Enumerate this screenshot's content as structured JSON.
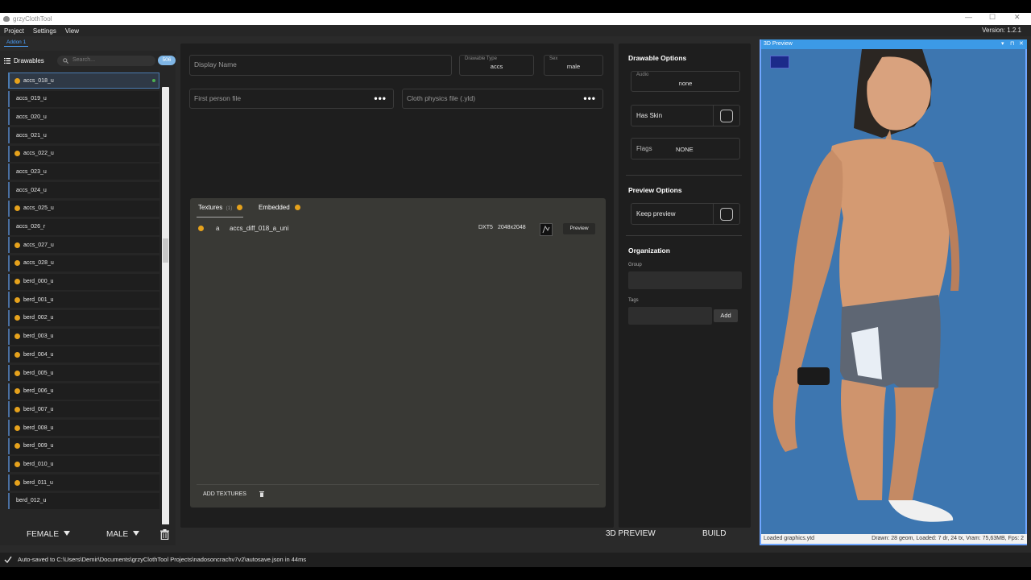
{
  "window": {
    "title": "grzyClothTool",
    "controls": [
      "—",
      "☐",
      "✕"
    ]
  },
  "menu": [
    "Project",
    "Settings",
    "View"
  ],
  "version": "Version: 1.2.1",
  "addon_tab": "Addon 1",
  "sidebar": {
    "header": "Drawables",
    "search_placeholder": "Search...",
    "count": "506",
    "items": [
      {
        "label": "accs_018_u",
        "warn": true,
        "selected": true
      },
      {
        "label": "accs_019_u",
        "warn": false
      },
      {
        "label": "accs_020_u",
        "warn": false
      },
      {
        "label": "accs_021_u",
        "warn": false
      },
      {
        "label": "accs_022_u",
        "warn": true
      },
      {
        "label": "accs_023_u",
        "warn": false
      },
      {
        "label": "accs_024_u",
        "warn": false
      },
      {
        "label": "accs_025_u",
        "warn": true
      },
      {
        "label": "accs_026_r",
        "warn": false
      },
      {
        "label": "accs_027_u",
        "warn": true
      },
      {
        "label": "accs_028_u",
        "warn": true
      },
      {
        "label": "berd_000_u",
        "warn": true
      },
      {
        "label": "berd_001_u",
        "warn": true
      },
      {
        "label": "berd_002_u",
        "warn": true
      },
      {
        "label": "berd_003_u",
        "warn": true
      },
      {
        "label": "berd_004_u",
        "warn": true
      },
      {
        "label": "berd_005_u",
        "warn": true
      },
      {
        "label": "berd_006_u",
        "warn": true
      },
      {
        "label": "berd_007_u",
        "warn": true
      },
      {
        "label": "berd_008_u",
        "warn": true
      },
      {
        "label": "berd_009_u",
        "warn": true
      },
      {
        "label": "berd_010_u",
        "warn": true
      },
      {
        "label": "berd_011_u",
        "warn": true
      },
      {
        "label": "berd_012_u",
        "warn": false
      }
    ],
    "female_label": "FEMALE",
    "male_label": "MALE"
  },
  "details": {
    "display_name_placeholder": "Display Name",
    "drawable_type_label": "Drawable Type",
    "drawable_type_value": "accs",
    "sex_label": "Sex",
    "sex_value": "male",
    "first_person_placeholder": "First person file",
    "cloth_physics_placeholder": "Cloth physics file (.yld)",
    "more": "•••"
  },
  "textures": {
    "tab_textures": "Textures",
    "tab_textures_count": "(1)",
    "tab_embedded": "Embedded",
    "rows": [
      {
        "letter": "a",
        "name": "accs_diff_018_a_uni",
        "format": "DXT5",
        "size": "2048x2048",
        "action": "Preview"
      }
    ],
    "add_label": "ADD TEXTURES"
  },
  "options": {
    "drawable_title": "Drawable Options",
    "audio_label": "Audio",
    "audio_value": "none",
    "has_skin": "Has Skin",
    "flags_label": "Flags",
    "flags_value": "NONE",
    "preview_title": "Preview Options",
    "keep_preview": "Keep preview",
    "org_title": "Organization",
    "group_label": "Group",
    "tags_label": "Tags",
    "add_label": "Add"
  },
  "actions": {
    "preview3d": "3D PREVIEW",
    "build": "BUILD"
  },
  "preview": {
    "title": "3D Preview",
    "controls": [
      "▾",
      "⊓",
      "✕"
    ],
    "status_left": "Loaded graphics.ytd",
    "status_right": "Drawn: 28 geom, Loaded: 7 dr, 24 tx, Vram: 75,63MB, Fps: 2",
    "colors": {
      "background": "#3d76b0",
      "title_bar": "#3c9ae6"
    }
  },
  "footer": {
    "message": "Auto-saved to C:\\Users\\Demir\\Documents\\grzyClothTool Projects\\nadosoncrachv7v2\\autosave.json in 44ms"
  },
  "colors": {
    "accent": "#4da3ff",
    "warning": "#e6a21c",
    "ok": "#4caf50"
  }
}
